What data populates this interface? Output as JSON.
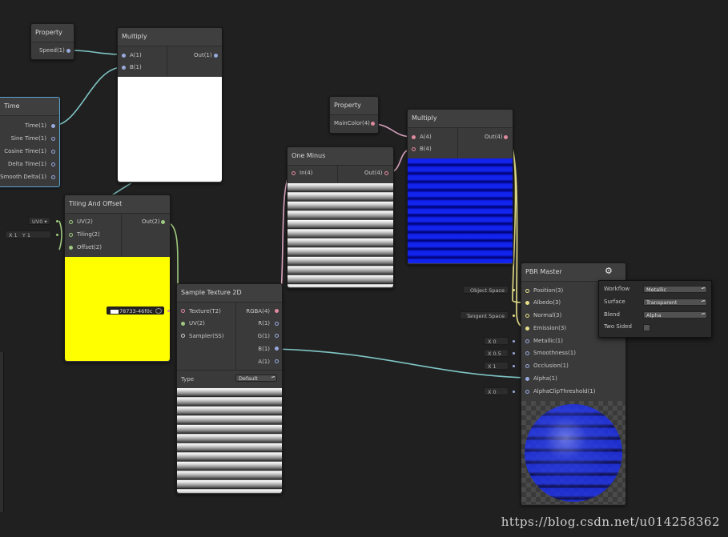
{
  "colors": {
    "background": "#202020",
    "node": "#3a3a3a",
    "selected_border": "#5ba8d6",
    "vector_wire": "#7fc4c4",
    "texture_wire": "#d9a3be",
    "uv_wire": "#9fc97f",
    "scalar_wire": "#e6e08a"
  },
  "property_speed": {
    "title": "Property",
    "output": "Speed(1)"
  },
  "multiply_1": {
    "title": "Multiply",
    "in_a": "A(1)",
    "in_b": "B(1)",
    "out": "Out(1)"
  },
  "time": {
    "title": "Time",
    "outputs": [
      "Time(1)",
      "Sine Time(1)",
      "Cosine Time(1)",
      "Delta Time(1)",
      "Smooth Delta(1)"
    ]
  },
  "tiling": {
    "title": "Tiling And Offset",
    "in_uv": "UV(2)",
    "in_tiling": "Tiling(2)",
    "in_offset": "Offset(2)",
    "out": "Out(2)",
    "uv_pill": "UV0",
    "tiling_x": "X 1",
    "tiling_y": "Y 1"
  },
  "property_color": {
    "title": "Property",
    "output": "MainColor(4)"
  },
  "one_minus": {
    "title": "One Minus",
    "in": "In(4)",
    "out": "Out(4)"
  },
  "multiply_2": {
    "title": "Multiply",
    "in_a": "A(4)",
    "in_b": "B(4)",
    "out": "Out(4)"
  },
  "sample": {
    "title": "Sample Texture 2D",
    "in_texture": "Texture(T2)",
    "in_uv": "UV(2)",
    "in_sampler": "Sampler(SS)",
    "outputs": [
      "RGBA(4)",
      "R(1)",
      "G(1)",
      "B(1)",
      "A(1)"
    ],
    "type_label": "Type",
    "type_value": "Default",
    "texture_field": "78733-46f0c"
  },
  "pbr": {
    "title": "PBR Master",
    "inputs": [
      "Position(3)",
      "Albedo(3)",
      "Normal(3)",
      "Emission(3)",
      "Metallic(1)",
      "Smoothness(1)",
      "Occlusion(1)",
      "Alpha(1)",
      "AlphaClipThreshold(1)"
    ],
    "object_space": "Object Space",
    "tangent_space": "Tangent Space",
    "metallic_val": "X 0",
    "smooth_val": "X 0.5",
    "occlusion_val": "X 1",
    "clip_val": "X 0"
  },
  "settings": {
    "workflow_label": "Workflow",
    "workflow_value": "Metallic",
    "surface_label": "Surface",
    "surface_value": "Transparent",
    "blend_label": "Blend",
    "blend_value": "Alpha",
    "two_sided_label": "Two Sided"
  },
  "watermark": "https://blog.csdn.net/u014258362"
}
